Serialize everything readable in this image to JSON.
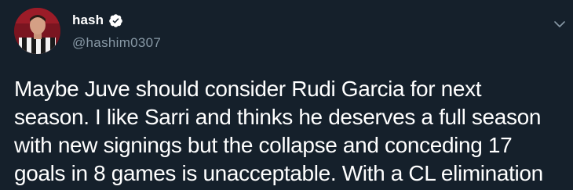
{
  "tweet": {
    "author": {
      "display_name": "hash",
      "handle": "@hashim0307",
      "verified_icon": "verified-badge-icon",
      "avatar": "avatar"
    },
    "text": "Maybe Juve should consider Rudi Garcia for next\nseason. I like Sarri and thinks he deserves a full season\nwith new signings but the collapse and conceding 17\ngoals in 8 games is unacceptable. With a CL elimination",
    "menu_icon": "chevron-down-icon"
  },
  "colors": {
    "background": "#15202b",
    "text_primary": "#ffffff",
    "text_secondary": "#8899a6"
  }
}
